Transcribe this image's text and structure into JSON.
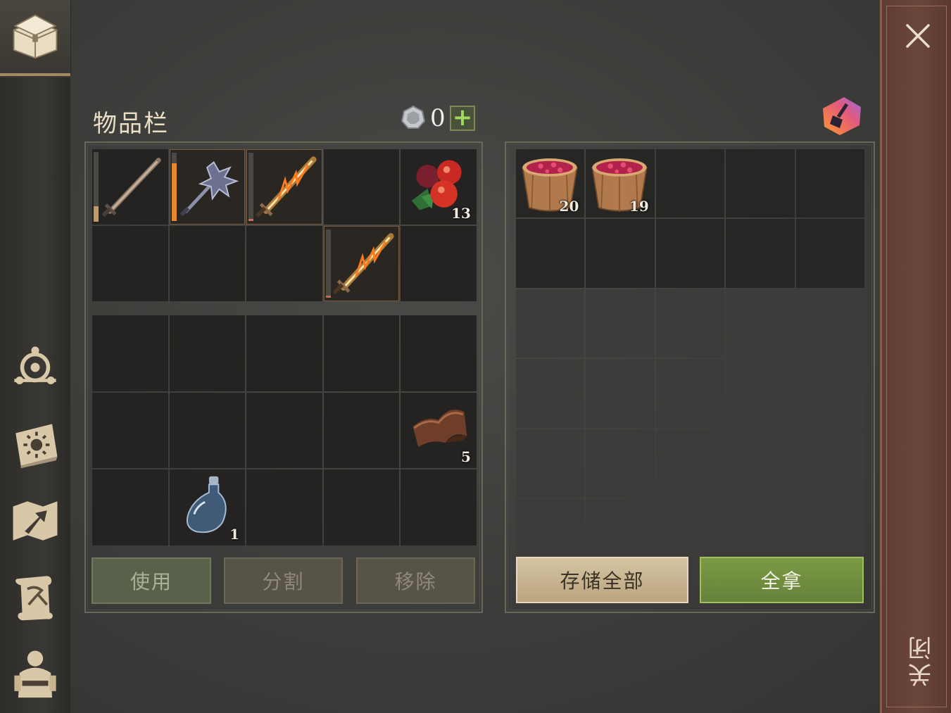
{
  "close": {
    "label": "关闭"
  },
  "inventory": {
    "title": "物品栏",
    "currency": "0",
    "add_symbol": "+",
    "slots": [
      {
        "icon": "wooden-sword-icon",
        "qty": ""
      },
      {
        "icon": "iron-mace-icon",
        "qty": ""
      },
      {
        "icon": "flame-sword-icon",
        "qty": ""
      },
      {
        "icon": "",
        "qty": ""
      },
      {
        "icon": "berries-icon",
        "qty": "13"
      },
      {
        "icon": "",
        "qty": ""
      },
      {
        "icon": "",
        "qty": ""
      },
      {
        "icon": "",
        "qty": ""
      },
      {
        "icon": "flame-sword-icon",
        "qty": ""
      },
      {
        "icon": "",
        "qty": ""
      }
    ],
    "backpack": [
      {
        "icon": "",
        "qty": ""
      },
      {
        "icon": "",
        "qty": ""
      },
      {
        "icon": "",
        "qty": ""
      },
      {
        "icon": "",
        "qty": ""
      },
      {
        "icon": "",
        "qty": ""
      },
      {
        "icon": "",
        "qty": ""
      },
      {
        "icon": "",
        "qty": ""
      },
      {
        "icon": "",
        "qty": ""
      },
      {
        "icon": "",
        "qty": ""
      },
      {
        "icon": "leather-icon",
        "qty": "5"
      },
      {
        "icon": "",
        "qty": ""
      },
      {
        "icon": "bottle-icon",
        "qty": "1"
      },
      {
        "icon": "",
        "qty": ""
      },
      {
        "icon": "",
        "qty": ""
      },
      {
        "icon": "",
        "qty": ""
      }
    ],
    "buttons": {
      "use": "使用",
      "split": "分割",
      "remove": "移除"
    }
  },
  "storage": {
    "slots": [
      {
        "icon": "berry-bucket-icon",
        "qty": "20"
      },
      {
        "icon": "berry-bucket-icon",
        "qty": "19"
      }
    ],
    "buttons": {
      "store_all": "存储全部",
      "take_all": "全拿"
    }
  }
}
